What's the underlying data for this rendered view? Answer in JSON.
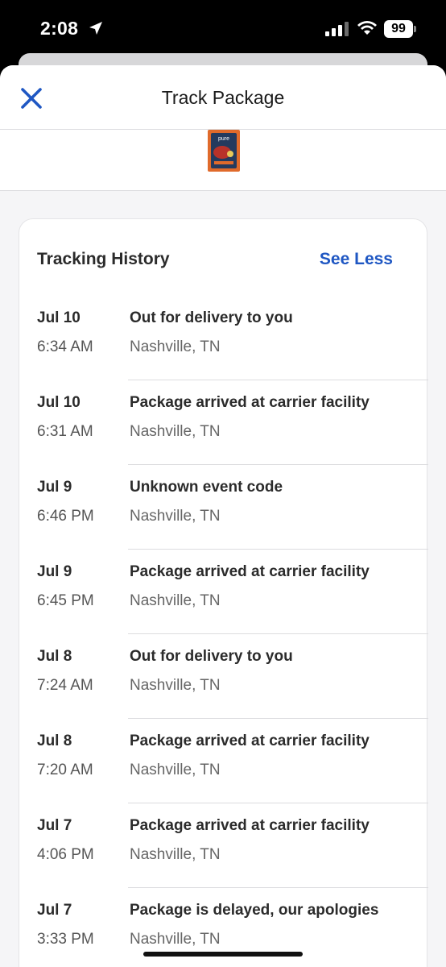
{
  "status_bar": {
    "time": "2:08",
    "battery": "99"
  },
  "header": {
    "title": "Track Package",
    "close_icon": "close-icon"
  },
  "product": {
    "image": "product-bag-thumbnail",
    "colors": {
      "bag": "#e06a2b",
      "label": "#243a5e"
    }
  },
  "tracking": {
    "title": "Tracking History",
    "toggle_label": "See Less",
    "events": [
      {
        "date": "Jul 10",
        "time": "6:34 AM",
        "status": "Out for delivery to you",
        "location": "Nashville, TN"
      },
      {
        "date": "Jul 10",
        "time": "6:31 AM",
        "status": "Package arrived at carrier facility",
        "location": "Nashville, TN"
      },
      {
        "date": "Jul 9",
        "time": "6:46 PM",
        "status": "Unknown event code",
        "location": "Nashville, TN"
      },
      {
        "date": "Jul 9",
        "time": "6:45 PM",
        "status": "Package arrived at carrier facility",
        "location": "Nashville, TN"
      },
      {
        "date": "Jul 8",
        "time": "7:24 AM",
        "status": "Out for delivery to you",
        "location": "Nashville, TN"
      },
      {
        "date": "Jul 8",
        "time": "7:20 AM",
        "status": "Package arrived at carrier facility",
        "location": "Nashville, TN"
      },
      {
        "date": "Jul 7",
        "time": "4:06 PM",
        "status": "Package arrived at carrier facility",
        "location": "Nashville, TN"
      },
      {
        "date": "Jul 7",
        "time": "3:33 PM",
        "status": "Package is delayed, our apologies",
        "location": "Nashville, TN"
      }
    ]
  },
  "colors": {
    "accent": "#1f57c3",
    "close_icon": "#1f57c3"
  }
}
